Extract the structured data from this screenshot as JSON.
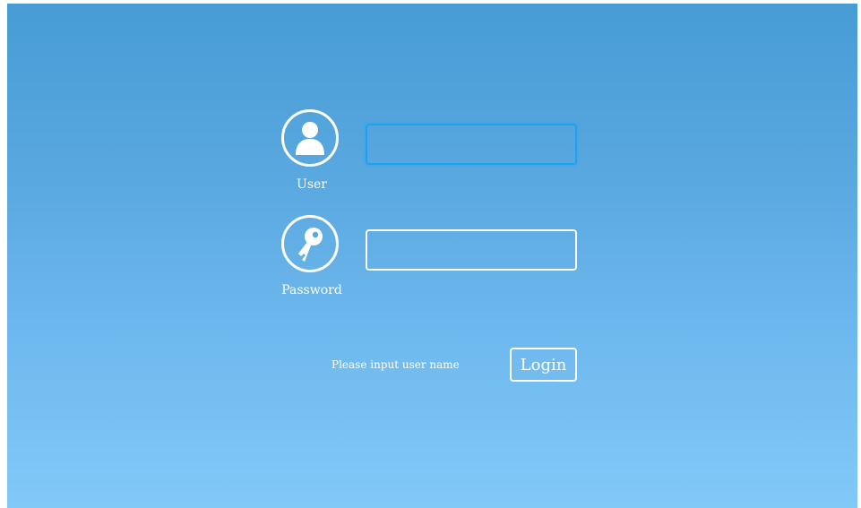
{
  "user": {
    "label": "User",
    "icon": "user-icon",
    "value": ""
  },
  "password": {
    "label": "Password",
    "icon": "key-icon",
    "value": ""
  },
  "status": {
    "message": "Please input user name"
  },
  "login": {
    "label": "Login"
  },
  "colors": {
    "background_top": "#479cd6",
    "background_bottom": "#82c9f8",
    "focus_border": "#1aa3f0",
    "text": "#ffffff"
  }
}
